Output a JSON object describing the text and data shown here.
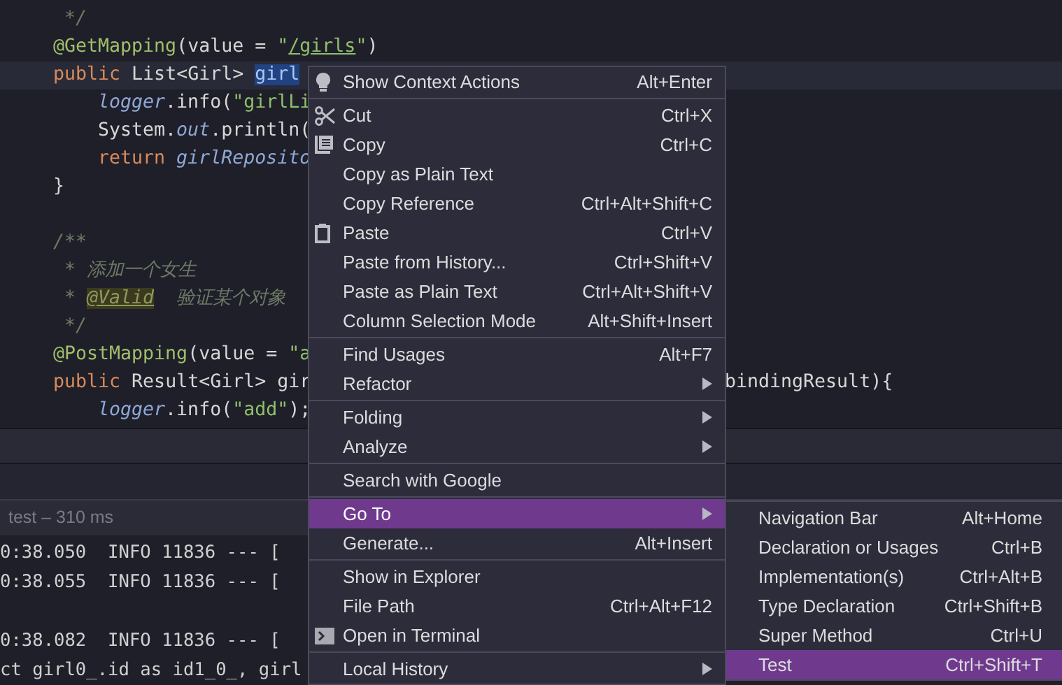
{
  "editor": {
    "lines": [
      {
        "current": false,
        "indented": false,
        "tokens": [
          {
            "text": " */",
            "kind": "comment"
          }
        ]
      },
      {
        "current": false,
        "indented": false,
        "tokens": [
          {
            "text": "@GetMapping",
            "kind": "annotation"
          },
          {
            "text": "(value = ",
            "kind": "plain"
          },
          {
            "text": "\"",
            "kind": "string"
          },
          {
            "text": "/girls",
            "kind": "url"
          },
          {
            "text": "\"",
            "kind": "string"
          },
          {
            "text": ")",
            "kind": "plain"
          }
        ]
      },
      {
        "current": true,
        "indented": false,
        "tokens": [
          {
            "text": "public ",
            "kind": "keyword"
          },
          {
            "text": "List<Girl> ",
            "kind": "plain"
          },
          {
            "text": "girl",
            "kind": "selected"
          }
        ]
      },
      {
        "current": false,
        "indented": true,
        "tokens": [
          {
            "text": "logger",
            "kind": "field"
          },
          {
            "text": ".info(",
            "kind": "plain"
          },
          {
            "text": "\"girlLi",
            "kind": "string"
          }
        ]
      },
      {
        "current": false,
        "indented": true,
        "tokens": [
          {
            "text": "System.",
            "kind": "plain"
          },
          {
            "text": "out",
            "kind": "field"
          },
          {
            "text": ".println(",
            "kind": "plain"
          }
        ]
      },
      {
        "current": false,
        "indented": true,
        "tokens": [
          {
            "text": "return ",
            "kind": "keyword"
          },
          {
            "text": "girlReposito",
            "kind": "field"
          }
        ]
      },
      {
        "current": false,
        "indented": false,
        "tokens": [
          {
            "text": "}",
            "kind": "plain"
          }
        ]
      },
      {
        "current": false,
        "indented": false
      },
      {
        "current": false,
        "indented": false,
        "tokens": [
          {
            "text": "/**",
            "kind": "comment"
          }
        ]
      },
      {
        "current": false,
        "indented": false,
        "tokens": [
          {
            "text": " * 添加一个女生",
            "kind": "comment"
          }
        ]
      },
      {
        "current": false,
        "indented": false,
        "tokens": [
          {
            "text": " * ",
            "kind": "comment"
          },
          {
            "text": "@Valid",
            "kind": "doctag"
          },
          {
            "text": "  验证某个对象",
            "kind": "comment"
          }
        ]
      },
      {
        "current": false,
        "indented": false,
        "tokens": [
          {
            "text": " */",
            "kind": "comment"
          }
        ]
      },
      {
        "current": false,
        "indented": false,
        "tokens": [
          {
            "text": "@PostMapping",
            "kind": "annotation"
          },
          {
            "text": "(value = ",
            "kind": "plain"
          },
          {
            "text": "\"a",
            "kind": "string"
          }
        ]
      },
      {
        "current": false,
        "indented": false,
        "tokens": [
          {
            "text": "public ",
            "kind": "keyword"
          },
          {
            "text": "Result<Girl> gir",
            "kind": "plain"
          }
        ],
        "tail": "bindingResult){"
      },
      {
        "current": false,
        "indented": true,
        "tokens": [
          {
            "text": "logger",
            "kind": "field"
          },
          {
            "text": ".info(",
            "kind": "plain"
          },
          {
            "text": "\"add\"",
            "kind": "string"
          },
          {
            "text": ");",
            "kind": "plain"
          }
        ]
      }
    ]
  },
  "run_panel": {
    "title": "test – 310 ms"
  },
  "console": {
    "lines": [
      {
        "kind": "log",
        "text": "0:38.050  INFO 11836 --- ["
      },
      {
        "kind": "log",
        "text": "0:38.055  INFO 11836 --- ["
      },
      {
        "kind": "blank"
      },
      {
        "kind": "log",
        "text": "0:38.082  INFO 11836 --- ["
      },
      {
        "kind": "log",
        "text": "ct girl0_.id as id1_0_, girl"
      }
    ]
  },
  "context_menu": {
    "groups": [
      [
        {
          "label": "Show Context Actions",
          "shortcut": "Alt+Enter",
          "submenu": false,
          "selected": false
        }
      ],
      [
        {
          "label": "Cut",
          "shortcut": "Ctrl+X",
          "submenu": false,
          "selected": false
        },
        {
          "label": "Copy",
          "shortcut": "Ctrl+C",
          "submenu": false,
          "selected": false
        },
        {
          "label": "Copy as Plain Text",
          "submenu": false,
          "selected": false
        },
        {
          "label": "Copy Reference",
          "shortcut": "Ctrl+Alt+Shift+C",
          "submenu": false,
          "selected": false
        },
        {
          "label": "Paste",
          "shortcut": "Ctrl+V",
          "submenu": false,
          "selected": false
        },
        {
          "label": "Paste from History...",
          "shortcut": "Ctrl+Shift+V",
          "submenu": false,
          "selected": false
        },
        {
          "label": "Paste as Plain Text",
          "shortcut": "Ctrl+Alt+Shift+V",
          "submenu": false,
          "selected": false
        },
        {
          "label": "Column Selection Mode",
          "shortcut": "Alt+Shift+Insert",
          "submenu": false,
          "selected": false
        }
      ],
      [
        {
          "label": "Find Usages",
          "shortcut": "Alt+F7",
          "submenu": false,
          "selected": false
        },
        {
          "label": "Refactor",
          "submenu": true,
          "selected": false
        }
      ],
      [
        {
          "label": "Folding",
          "submenu": true,
          "selected": false
        },
        {
          "label": "Analyze",
          "submenu": true,
          "selected": false
        }
      ],
      [
        {
          "label": "Search with Google",
          "submenu": false,
          "selected": false
        }
      ],
      [
        {
          "label": "Go To",
          "submenu": true,
          "selected": true
        },
        {
          "label": "Generate...",
          "shortcut": "Alt+Insert",
          "submenu": false,
          "selected": false
        }
      ],
      [
        {
          "label": "Show in Explorer",
          "submenu": false,
          "selected": false
        },
        {
          "label": "File Path",
          "shortcut": "Ctrl+Alt+F12",
          "submenu": false,
          "selected": false
        },
        {
          "label": "Open in Terminal",
          "submenu": false,
          "selected": false
        }
      ],
      [
        {
          "label": "Local History",
          "submenu": true,
          "selected": false
        }
      ]
    ]
  },
  "goto_submenu": {
    "items": [
      {
        "label": "Navigation Bar",
        "shortcut": "Alt+Home",
        "selected": false
      },
      {
        "label": "Declaration or Usages",
        "shortcut": "Ctrl+B",
        "selected": false
      },
      {
        "label": "Implementation(s)",
        "shortcut": "Ctrl+Alt+B",
        "selected": false
      },
      {
        "label": "Type Declaration",
        "shortcut": "Ctrl+Shift+B",
        "selected": false
      },
      {
        "label": "Super Method",
        "shortcut": "Ctrl+U",
        "selected": false
      },
      {
        "label": "Test",
        "shortcut": "Ctrl+Shift+T",
        "selected": true
      }
    ]
  }
}
